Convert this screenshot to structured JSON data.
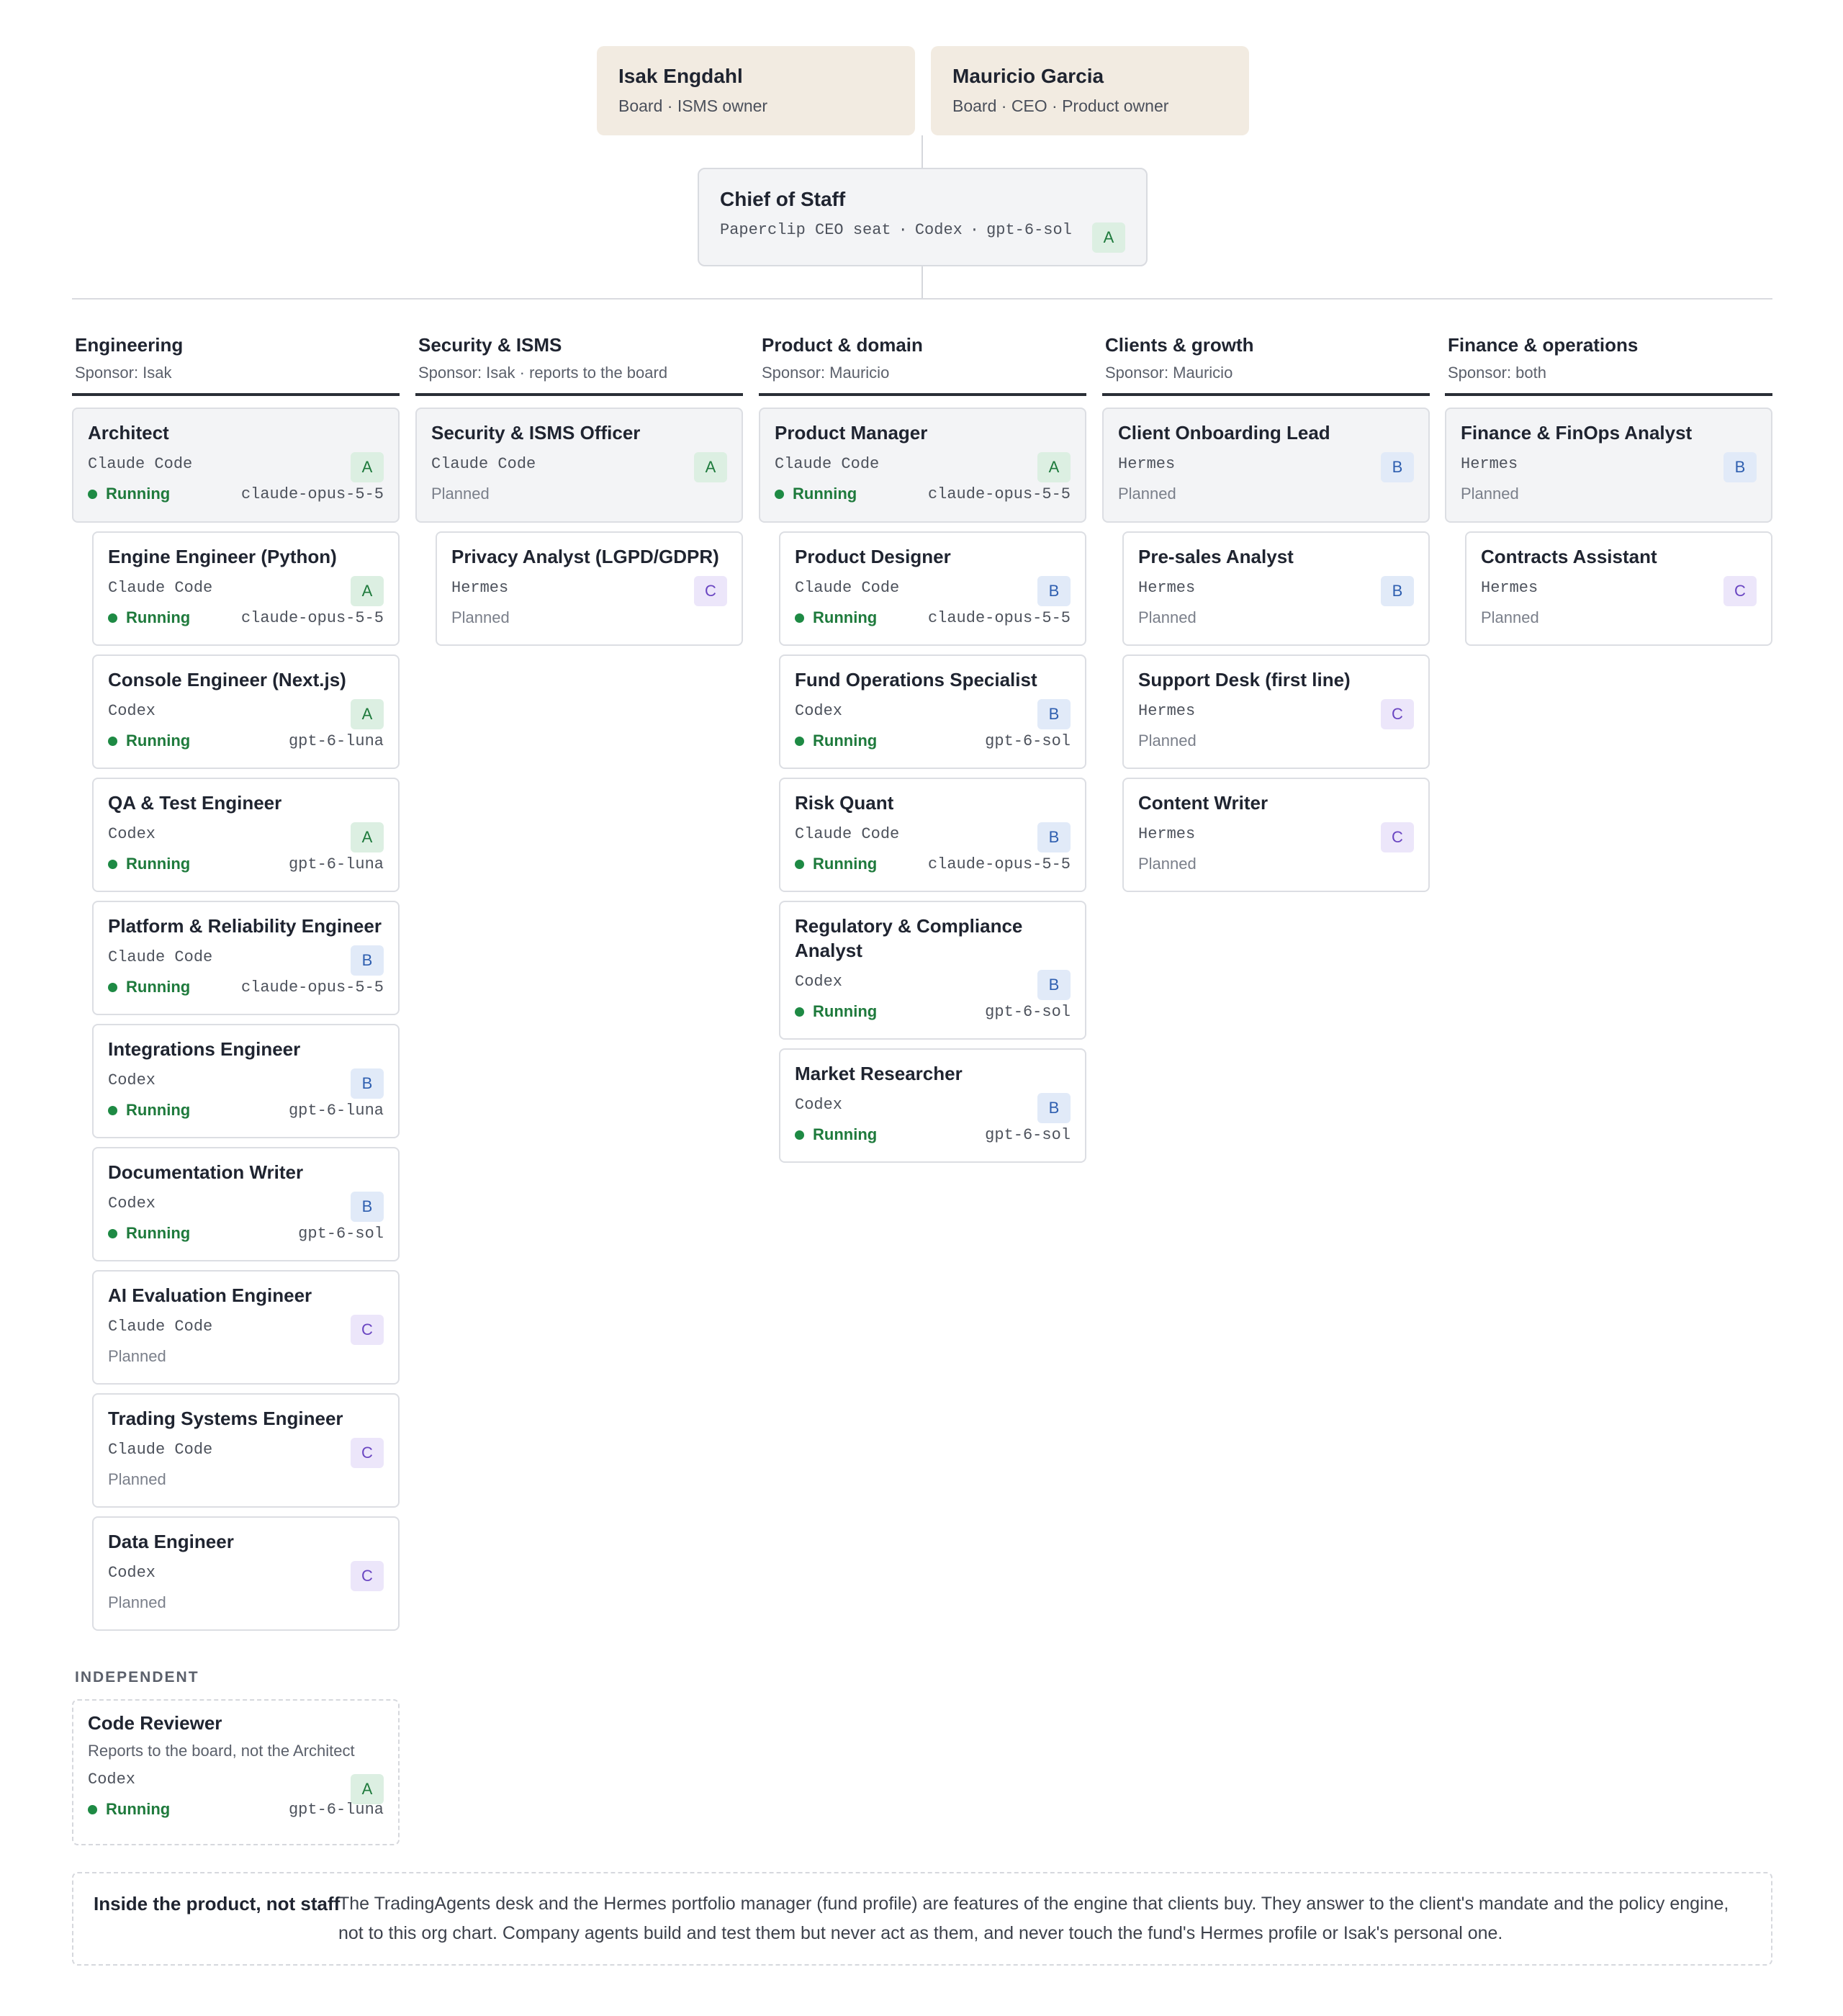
{
  "board": [
    {
      "name": "Isak Engdahl",
      "role": "Board · ISMS owner"
    },
    {
      "name": "Mauricio Garcia",
      "role": "Board · CEO · Product owner"
    }
  ],
  "chief": {
    "title": "Chief of Staff",
    "seat": "Paperclip CEO seat",
    "engine": "Codex",
    "model": "gpt-6-sol",
    "tier": "A"
  },
  "columns": [
    {
      "title": "Engineering",
      "sponsor": "Sponsor: Isak",
      "lead": {
        "title": "Architect",
        "engine": "Claude Code",
        "tier": "A",
        "status": "Running",
        "model": "claude-opus-5-5"
      },
      "reports": [
        {
          "title": "Engine Engineer (Python)",
          "engine": "Claude Code",
          "tier": "A",
          "status": "Running",
          "model": "claude-opus-5-5"
        },
        {
          "title": "Console Engineer (Next.js)",
          "engine": "Codex",
          "tier": "A",
          "status": "Running",
          "model": "gpt-6-luna"
        },
        {
          "title": "QA & Test Engineer",
          "engine": "Codex",
          "tier": "A",
          "status": "Running",
          "model": "gpt-6-luna"
        },
        {
          "title": "Platform & Reliability Engineer",
          "engine": "Claude Code",
          "tier": "B",
          "status": "Running",
          "model": "claude-opus-5-5"
        },
        {
          "title": "Integrations Engineer",
          "engine": "Codex",
          "tier": "B",
          "status": "Running",
          "model": "gpt-6-luna"
        },
        {
          "title": "Documentation Writer",
          "engine": "Codex",
          "tier": "B",
          "status": "Running",
          "model": "gpt-6-sol"
        },
        {
          "title": "AI Evaluation Engineer",
          "engine": "Claude Code",
          "tier": "C",
          "status": "Planned",
          "model": ""
        },
        {
          "title": "Trading Systems Engineer",
          "engine": "Claude Code",
          "tier": "C",
          "status": "Planned",
          "model": ""
        },
        {
          "title": "Data Engineer",
          "engine": "Codex",
          "tier": "C",
          "status": "Planned",
          "model": ""
        }
      ]
    },
    {
      "title": "Security & ISMS",
      "sponsor": "Sponsor: Isak · reports to the board",
      "lead": {
        "title": "Security & ISMS Officer",
        "engine": "Claude Code",
        "tier": "A",
        "status": "Planned",
        "model": ""
      },
      "reports": [
        {
          "title": "Privacy Analyst (LGPD/GDPR)",
          "engine": "Hermes",
          "tier": "C",
          "status": "Planned",
          "model": ""
        }
      ]
    },
    {
      "title": "Product & domain",
      "sponsor": "Sponsor: Mauricio",
      "lead": {
        "title": "Product Manager",
        "engine": "Claude Code",
        "tier": "A",
        "status": "Running",
        "model": "claude-opus-5-5"
      },
      "reports": [
        {
          "title": "Product Designer",
          "engine": "Claude Code",
          "tier": "B",
          "status": "Running",
          "model": "claude-opus-5-5"
        },
        {
          "title": "Fund Operations Specialist",
          "engine": "Codex",
          "tier": "B",
          "status": "Running",
          "model": "gpt-6-sol"
        },
        {
          "title": "Risk Quant",
          "engine": "Claude Code",
          "tier": "B",
          "status": "Running",
          "model": "claude-opus-5-5"
        },
        {
          "title": "Regulatory & Compliance Analyst",
          "engine": "Codex",
          "tier": "B",
          "status": "Running",
          "model": "gpt-6-sol"
        },
        {
          "title": "Market Researcher",
          "engine": "Codex",
          "tier": "B",
          "status": "Running",
          "model": "gpt-6-sol"
        }
      ]
    },
    {
      "title": "Clients & growth",
      "sponsor": "Sponsor: Mauricio",
      "lead": {
        "title": "Client Onboarding Lead",
        "engine": "Hermes",
        "tier": "B",
        "status": "Planned",
        "model": ""
      },
      "reports": [
        {
          "title": "Pre-sales Analyst",
          "engine": "Hermes",
          "tier": "B",
          "status": "Planned",
          "model": ""
        },
        {
          "title": "Support Desk (first line)",
          "engine": "Hermes",
          "tier": "C",
          "status": "Planned",
          "model": ""
        },
        {
          "title": "Content Writer",
          "engine": "Hermes",
          "tier": "C",
          "status": "Planned",
          "model": ""
        }
      ]
    },
    {
      "title": "Finance & operations",
      "sponsor": "Sponsor: both",
      "lead": {
        "title": "Finance & FinOps Analyst",
        "engine": "Hermes",
        "tier": "B",
        "status": "Planned",
        "model": ""
      },
      "reports": [
        {
          "title": "Contracts Assistant",
          "engine": "Hermes",
          "tier": "C",
          "status": "Planned",
          "model": ""
        }
      ]
    }
  ],
  "independent": {
    "label": "INDEPENDENT",
    "title": "Code Reviewer",
    "note": "Reports to the board, not the Architect",
    "engine": "Codex",
    "tier": "A",
    "status": "Running",
    "model": "gpt-6-luna"
  },
  "footer": {
    "heading": "Inside the product, not staff",
    "body": "The TradingAgents desk and the Hermes portfolio manager (fund profile) are features of the engine that clients buy. They answer to the client's mandate and the policy engine, not to this org chart. Company agents build and test them but never act as them, and never touch the fund's Hermes profile or Isak's personal one."
  }
}
